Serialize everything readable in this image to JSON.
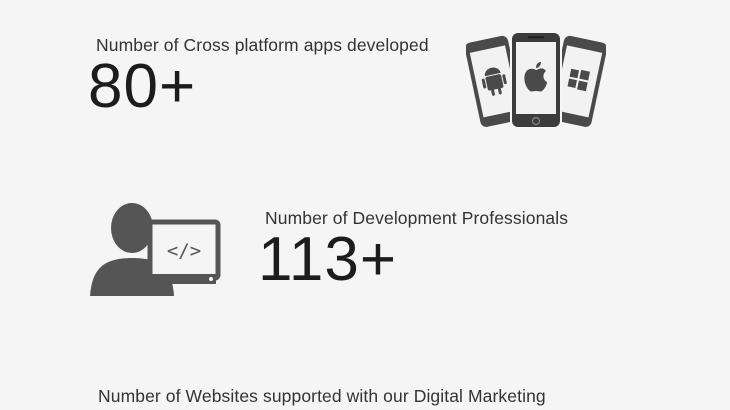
{
  "stats": [
    {
      "label": "Number of Cross platform apps developed",
      "value": "80+",
      "icon": "cross-platform-phones-icon"
    },
    {
      "label": "Number of Development Professionals",
      "value": "113+",
      "icon": "developer-code-icon"
    },
    {
      "label": "Number of Websites supported with our Digital Marketing",
      "value": "",
      "icon": ""
    }
  ],
  "icons": {
    "code_glyph": "</>"
  },
  "colors": {
    "background": "#f5f5f5",
    "icon": "#555555",
    "text": "#222222"
  }
}
